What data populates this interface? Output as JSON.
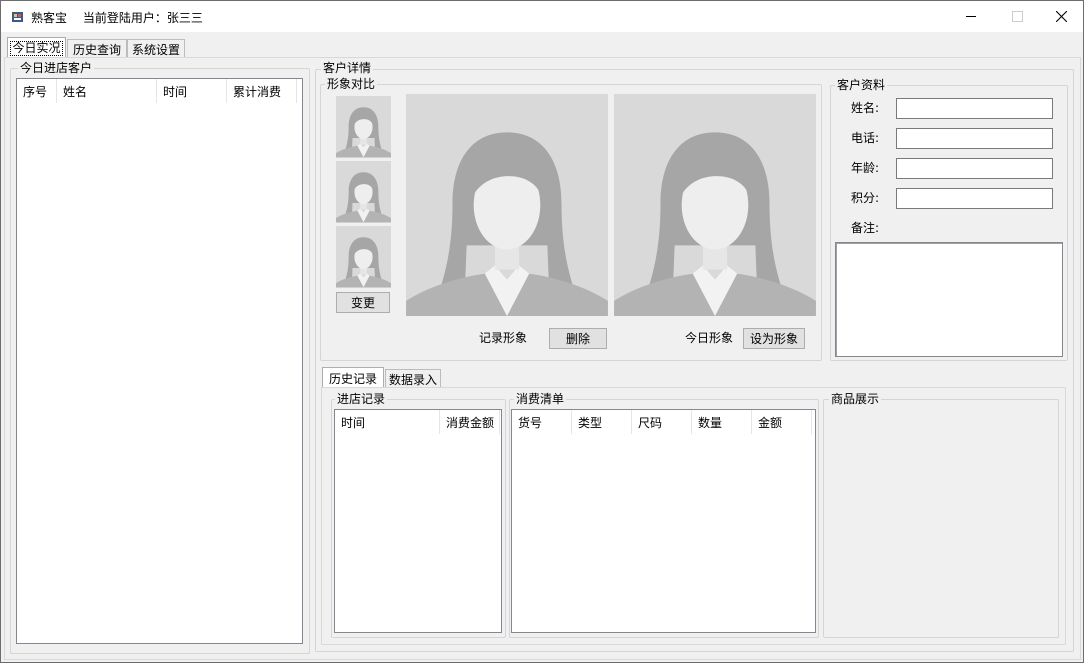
{
  "window": {
    "app_name": "熟客宝",
    "user_label": "当前登陆用户：张三三",
    "controls": {
      "minimize": "minimize-icon",
      "maximize": "maximize-icon",
      "close": "close-icon"
    }
  },
  "main_tabs": [
    {
      "label": "今日实况",
      "active": true
    },
    {
      "label": "历史查询",
      "active": false
    },
    {
      "label": "系统设置",
      "active": false
    }
  ],
  "visitors": {
    "title": "今日进店客户",
    "columns": [
      "序号",
      "姓名",
      "时间",
      "累计消费"
    ],
    "rows": []
  },
  "customer_detail": {
    "title": "客户详情",
    "compare": {
      "title": "形象对比",
      "change_button": "变更",
      "record_label": "记录形象",
      "delete_button": "删除",
      "today_label": "今日形象",
      "set_button": "设为形象"
    },
    "profile": {
      "title": "客户资料",
      "name_label": "姓名:",
      "phone_label": "电话:",
      "age_label": "年龄:",
      "points_label": "积分:",
      "note_label": "备注:",
      "name_value": "",
      "phone_value": "",
      "age_value": "",
      "points_value": "",
      "note_value": ""
    }
  },
  "bottom_tabs": [
    {
      "label": "历史记录",
      "active": true
    },
    {
      "label": "数据录入",
      "active": false
    }
  ],
  "visit_records": {
    "title": "进店记录",
    "columns": [
      "时间",
      "消费金额"
    ],
    "rows": []
  },
  "purchase_list": {
    "title": "消费清单",
    "columns": [
      "货号",
      "类型",
      "尺码",
      "数量",
      "金额"
    ],
    "rows": []
  },
  "product_display": {
    "title": "商品展示"
  },
  "colors": {
    "window_bg": "#f0f0f0",
    "photo_bg": "#d9d9d9",
    "button_bg": "#e1e1e1"
  }
}
